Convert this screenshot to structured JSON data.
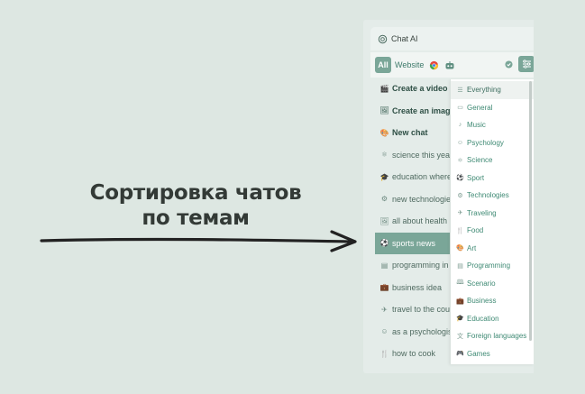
{
  "caption": {
    "line1": "Сортировка чатов",
    "line2": "по темам"
  },
  "app": {
    "title": "Chat AI",
    "logo_icon": "openai-logo-icon"
  },
  "tabs": {
    "all": "All",
    "website": "Website",
    "browser_icon": "chrome-icon",
    "bot_icon": "robot-icon",
    "check_icon": "check-circle-icon",
    "filter_icon": "sliders-icon"
  },
  "chats": [
    {
      "icon": "🎬",
      "label": "Create a video",
      "bold": true
    },
    {
      "icon": "🖼",
      "label": "Create an image",
      "bold": true
    },
    {
      "icon": "🎨",
      "label": "New chat",
      "bold": true
    },
    {
      "icon": "⚛",
      "label": "science this year"
    },
    {
      "icon": "🎓",
      "label": "education where"
    },
    {
      "icon": "⚙",
      "label": "new technologies"
    },
    {
      "icon": "🖼",
      "label": "all about health"
    },
    {
      "icon": "⚽",
      "label": "sports news",
      "active": true
    },
    {
      "icon": "▤",
      "label": "programming in"
    },
    {
      "icon": "💼",
      "label": "business idea"
    },
    {
      "icon": "✈",
      "label": "travel to the country"
    },
    {
      "icon": "☺",
      "label": "as a psychologist"
    },
    {
      "icon": "🍴",
      "label": "how to cook"
    }
  ],
  "topics": [
    {
      "icon": "☰",
      "label": "Everything"
    },
    {
      "icon": "▭",
      "label": "General"
    },
    {
      "icon": "♪",
      "label": "Music"
    },
    {
      "icon": "☺",
      "label": "Psychology"
    },
    {
      "icon": "⚛",
      "label": "Science"
    },
    {
      "icon": "⚽",
      "label": "Sport"
    },
    {
      "icon": "⚙",
      "label": "Technologies"
    },
    {
      "icon": "✈",
      "label": "Traveling"
    },
    {
      "icon": "🍴",
      "label": "Food"
    },
    {
      "icon": "🎨",
      "label": "Art"
    },
    {
      "icon": "▤",
      "label": "Programming"
    },
    {
      "icon": "🕮",
      "label": "Scenario"
    },
    {
      "icon": "💼",
      "label": "Business"
    },
    {
      "icon": "🎓",
      "label": "Education"
    },
    {
      "icon": "文",
      "label": "Foreign languages"
    },
    {
      "icon": "🎮",
      "label": "Games"
    }
  ],
  "colors": {
    "accent": "#7aa698",
    "background": "#dde7e2",
    "text_dark": "#333a36"
  }
}
